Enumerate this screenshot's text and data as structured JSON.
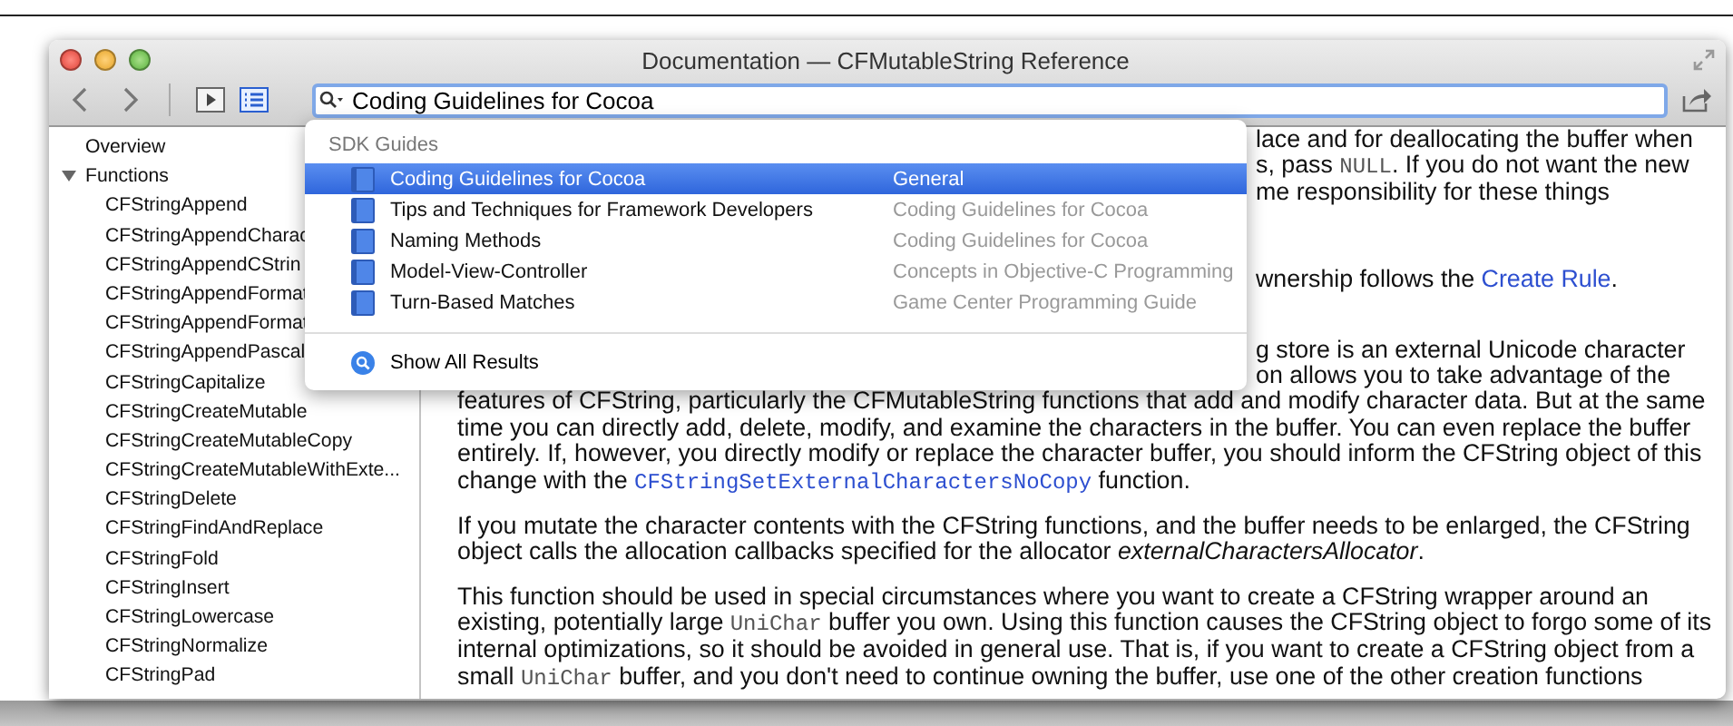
{
  "window": {
    "title": "Documentation — CFMutableString Reference"
  },
  "toolbar": {
    "search": {
      "value": "Coding Guidelines for Cocoa"
    }
  },
  "popup": {
    "section": "SDK Guides",
    "results": [
      {
        "title": "Coding Guidelines for Cocoa",
        "source": "General",
        "selected": true
      },
      {
        "title": "Tips and Techniques for Framework Developers",
        "source": "Coding Guidelines for Cocoa",
        "selected": false
      },
      {
        "title": "Naming Methods",
        "source": "Coding Guidelines for Cocoa",
        "selected": false
      },
      {
        "title": "Model-View-Controller",
        "source": "Concepts in Objective-C Programming",
        "selected": false
      },
      {
        "title": "Turn-Based Matches",
        "source": "Game Center Programming Guide",
        "selected": false
      }
    ],
    "show_all": "Show All Results"
  },
  "sidebar": {
    "items": [
      {
        "label": "Overview",
        "kind": "link"
      },
      {
        "label": "Functions",
        "kind": "group",
        "expanded": true,
        "children": [
          {
            "label": "CFStringAppend"
          },
          {
            "label": "CFStringAppendCharac"
          },
          {
            "label": "CFStringAppendCStrin"
          },
          {
            "label": "CFStringAppendFormat"
          },
          {
            "label": "CFStringAppendFormat"
          },
          {
            "label": "CFStringAppendPascal"
          },
          {
            "label": "CFStringCapitalize"
          },
          {
            "label": "CFStringCreateMutable"
          },
          {
            "label": "CFStringCreateMutableCopy"
          },
          {
            "label": "CFStringCreateMutableWithExte..."
          },
          {
            "label": "CFStringDelete"
          },
          {
            "label": "CFStringFindAndReplace"
          },
          {
            "label": "CFStringFold"
          },
          {
            "label": "CFStringInsert"
          },
          {
            "label": "CFStringLowercase"
          },
          {
            "label": "CFStringNormalize"
          },
          {
            "label": "CFStringPad"
          }
        ]
      }
    ]
  },
  "doc": {
    "fragments": [
      {
        "runs": [
          {
            "kind": "text",
            "text": "lace and for deallocating the buffer when"
          }
        ]
      },
      {
        "runs": [
          {
            "kind": "text",
            "text": "s, pass "
          },
          {
            "kind": "code",
            "text": "NULL"
          },
          {
            "kind": "text",
            "text": ". If you do not want the new"
          }
        ]
      },
      {
        "runs": [
          {
            "kind": "text",
            "text": "me responsibility for these things"
          }
        ]
      },
      {
        "runs": [
          {
            "kind": "text",
            "text": "wnership follows the "
          },
          {
            "kind": "link",
            "text": "Create Rule"
          },
          {
            "kind": "text",
            "text": "."
          }
        ]
      },
      {
        "runs": [
          {
            "kind": "text",
            "text": "g store is an external Unicode character"
          }
        ]
      },
      {
        "runs": [
          {
            "kind": "text",
            "text": "on allows you to take advantage of the"
          }
        ]
      }
    ],
    "paragraphs": [
      {
        "runs": [
          {
            "kind": "text",
            "text": "features of CFString, particularly the CFMutableString functions that add and modify character data. But at the same time you can directly add, delete, modify, and examine the characters in the buffer. You can even replace the buffer entirely. If, however, you directly modify or replace the character buffer, you should inform the CFString object of this change with the "
          },
          {
            "kind": "codelink",
            "text": "CFStringSetExternalCharactersNoCopy"
          },
          {
            "kind": "text",
            "text": " function."
          }
        ]
      },
      {
        "runs": [
          {
            "kind": "text",
            "text": "If you mutate the character contents with the CFString functions, and the buffer needs to be enlarged, the CFString object calls the allocation callbacks specified for the allocator "
          },
          {
            "kind": "em",
            "text": "externalCharactersAllocator"
          },
          {
            "kind": "text",
            "text": "."
          }
        ]
      },
      {
        "runs": [
          {
            "kind": "text",
            "text": "This function should be used in special circumstances where you want to create a CFString wrapper around an existing, potentially large "
          },
          {
            "kind": "code",
            "text": "UniChar"
          },
          {
            "kind": "text",
            "text": " buffer you own. Using this function causes the CFString object to forgo some of its internal optimizations, so it should be avoided in general use. That is, if you want to create a CFString object from a small "
          },
          {
            "kind": "code",
            "text": "UniChar"
          },
          {
            "kind": "text",
            "text": " buffer, and you don't need to continue owning the buffer, use one of the other creation functions"
          }
        ]
      }
    ]
  }
}
